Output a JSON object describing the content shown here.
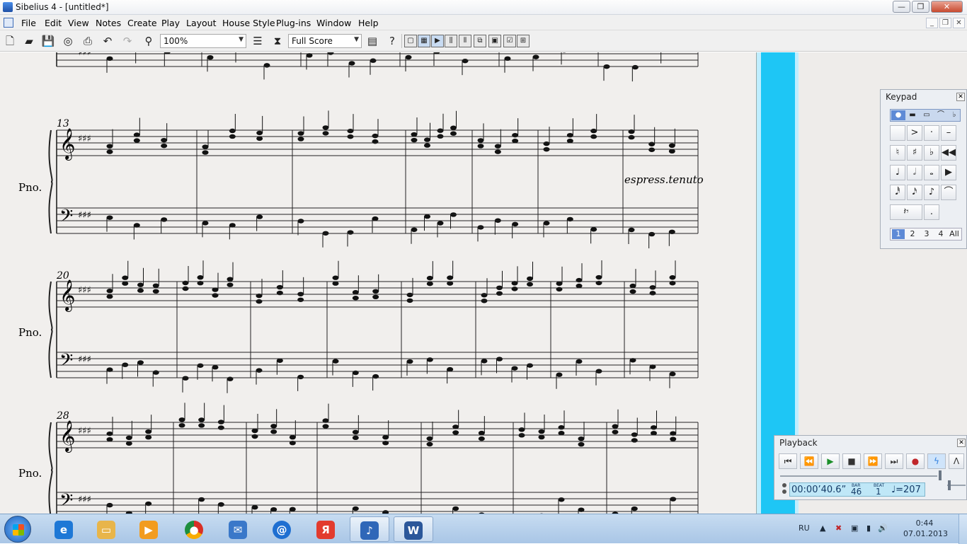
{
  "window": {
    "title": "Sibelius 4 - [untitled*]",
    "controls": [
      "—",
      "❐",
      "✕"
    ]
  },
  "menubar": {
    "items": [
      "File",
      "Edit",
      "View",
      "Notes",
      "Create",
      "Play",
      "Layout",
      "House Style",
      "Plug-ins",
      "Window",
      "Help"
    ],
    "mdi_controls": [
      "_",
      "❐",
      "✕"
    ]
  },
  "toolbar": {
    "zoom_value": "100%",
    "view_value": "Full Score"
  },
  "score": {
    "bar_numbers": [
      "13",
      "20",
      "28"
    ],
    "instrument_label": "Pno.",
    "expression_text": "espress.tenuto"
  },
  "keypad": {
    "title": "Keypad",
    "layout_tabs": [
      "1",
      "2",
      "3",
      "4",
      "All"
    ],
    "selected_layout": "1"
  },
  "playback": {
    "title": "Playback",
    "time": "00:00’40.6”",
    "bar_label": "BAR",
    "bar_value": "46",
    "beat_label": "BEAT",
    "beat_value": "1",
    "tempo": "♩=207"
  },
  "taskbar": {
    "language": "RU",
    "time": "0:44",
    "date": "07.01.2013"
  },
  "colors": {
    "paper": "#f1efed",
    "accent_bar": "#1ec6f5",
    "playback_display": "#bfe7f7",
    "selected_layout": "#5e8ad6"
  }
}
